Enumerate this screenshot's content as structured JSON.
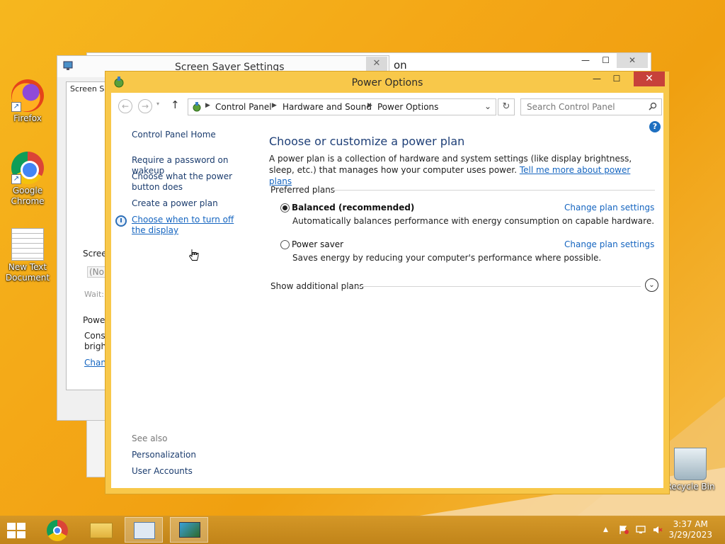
{
  "desktop": {
    "icons": [
      {
        "label": "Firefox"
      },
      {
        "label": "Google Chrome"
      },
      {
        "label": "New Text Document"
      },
      {
        "label": "Recycle Bin"
      }
    ]
  },
  "back_windows": {
    "screen_saver": {
      "title": "Screen Saver Settings",
      "tab": "Screen Sa",
      "group1": "Screer",
      "dropdown": "(Nor",
      "wait": "Wait:",
      "group2": "Powe",
      "text1": "Consu",
      "text2": "bright",
      "link": "Chan"
    },
    "personalization": {
      "title_fragment": "on"
    }
  },
  "window": {
    "title": "Power Options",
    "breadcrumbs": [
      "Control Panel",
      "Hardware and Sound",
      "Power Options"
    ],
    "search_placeholder": "Search Control Panel",
    "left_nav": {
      "home": "Control Panel Home",
      "items": [
        "Require a password on wakeup",
        "Choose what the power button does",
        "Create a power plan",
        "Choose when to turn off the display"
      ],
      "see_also_label": "See also",
      "see_also": [
        "Personalization",
        "User Accounts"
      ]
    },
    "main": {
      "heading": "Choose or customize a power plan",
      "intro": "A power plan is a collection of hardware and system settings (like display brightness, sleep, etc.) that manages how your computer uses power.",
      "intro_link": "Tell me more about power plans",
      "preferred_label": "Preferred plans",
      "plans": [
        {
          "name": "Balanced (recommended)",
          "selected": true,
          "desc": "Automatically balances performance with energy consumption on capable hardware.",
          "link": "Change plan settings"
        },
        {
          "name": "Power saver",
          "selected": false,
          "desc": "Saves energy by reducing your computer's performance where possible.",
          "link": "Change plan settings"
        }
      ],
      "additional_label": "Show additional plans"
    }
  },
  "taskbar": {
    "time": "3:37 AM",
    "date": "3/29/2023"
  },
  "colors": {
    "accent": "#f8c84a",
    "close_red": "#c7413a",
    "link_blue": "#1565c0",
    "heading_blue": "#1e3f77"
  }
}
